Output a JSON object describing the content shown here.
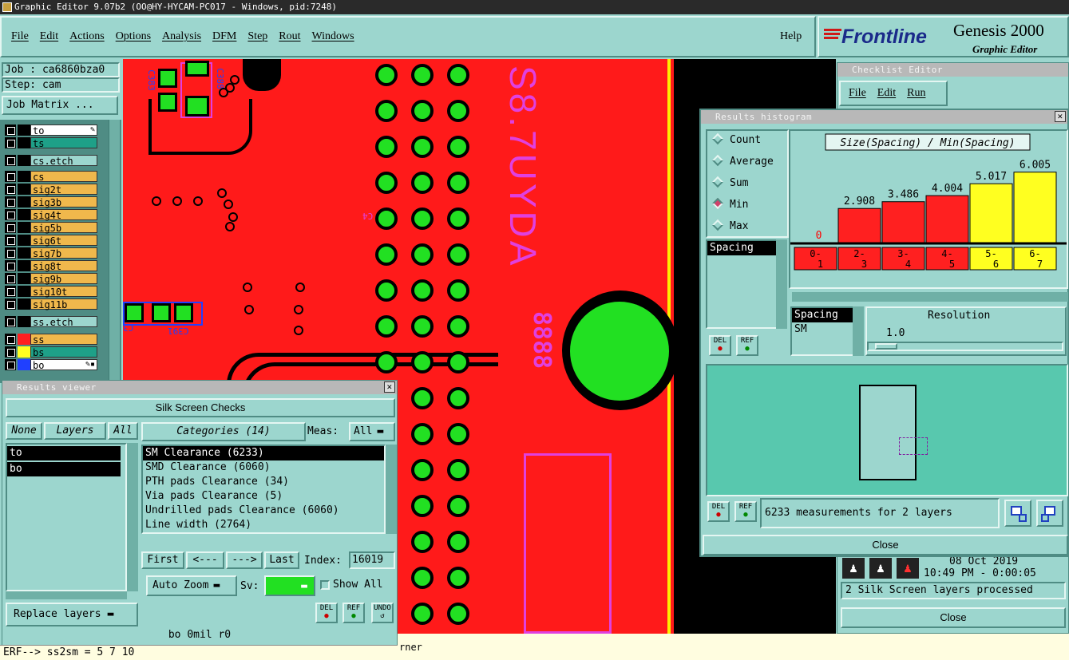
{
  "window_title": "Graphic Editor 9.07b2 (OO@HY-HYCAM-PC017 - Windows, pid:7248)",
  "menu": [
    "File",
    "Edit",
    "Actions",
    "Options",
    "Analysis",
    "DFM",
    "Step",
    "Rout",
    "Windows"
  ],
  "help_label": "Help",
  "brand": {
    "logo": "Frontline",
    "product": "Genesis 2000",
    "sub": "Graphic Editor",
    "accent": "#d01818"
  },
  "job": {
    "job_label": "Job : ca6860bza0",
    "step_label": "Step: cam",
    "matrix_button": "Job Matrix ..."
  },
  "layers": [
    {
      "name": "to",
      "color": "#000000",
      "bg": "#ffffff",
      "flag": "✎"
    },
    {
      "name": "ts",
      "color": "#000000",
      "bg": "#1ea088"
    },
    {
      "name": "cs.etch",
      "color": "#000000",
      "bg": "#9cd6ce"
    },
    {
      "name": "cs",
      "color": "#000000",
      "bg": "#f0b84c"
    },
    {
      "name": "sig2t",
      "color": "#000000",
      "bg": "#f0b84c"
    },
    {
      "name": "sig3b",
      "color": "#000000",
      "bg": "#f0b84c"
    },
    {
      "name": "sig4t",
      "color": "#000000",
      "bg": "#f0b84c"
    },
    {
      "name": "sig5b",
      "color": "#000000",
      "bg": "#f0b84c"
    },
    {
      "name": "sig6t",
      "color": "#000000",
      "bg": "#f0b84c"
    },
    {
      "name": "sig7b",
      "color": "#000000",
      "bg": "#f0b84c"
    },
    {
      "name": "sig8t",
      "color": "#000000",
      "bg": "#f0b84c"
    },
    {
      "name": "sig9b",
      "color": "#000000",
      "bg": "#f0b84c"
    },
    {
      "name": "sig10t",
      "color": "#000000",
      "bg": "#f0b84c"
    },
    {
      "name": "sig11b",
      "color": "#000000",
      "bg": "#f0b84c"
    },
    {
      "name": "ss.etch",
      "color": "#000000",
      "bg": "#9cd6ce"
    },
    {
      "name": "ss",
      "color": "#ff2020",
      "bg": "#f0b84c"
    },
    {
      "name": "bs",
      "color": "#ffff20",
      "bg": "#1ea088"
    },
    {
      "name": "bo",
      "color": "#2040ff",
      "bg": "#ffffff",
      "flag": "✎▪"
    }
  ],
  "canvas_text": {
    "silk_large": "S8.7UYDA",
    "silk_code": "8888",
    "ref1": "C383",
    "ref2": "C388",
    "ref3": "C391",
    "ref4": "C4",
    "ref5": "C3"
  },
  "results_viewer": {
    "title": "Results viewer",
    "header": "Silk Screen Checks",
    "none_btn": "None",
    "layers_btn": "Layers",
    "all_btn": "All",
    "layer_list": [
      "to",
      "bo"
    ],
    "categories_label": "Categories (14)",
    "meas_label": "Meas:",
    "meas_value": "All",
    "categories": [
      "SM Clearance (6233)",
      "SMD Clearance (6060)",
      "PTH pads Clearance (34)",
      "Via pads Clearance (5)",
      "Undrilled pads Clearance (6060)",
      "Line width (2764)"
    ],
    "first": "First",
    "prev": "<---",
    "next": "--->",
    "last": "Last",
    "index_label": "Index:",
    "index_value": "16019",
    "auto_zoom": "Auto Zoom",
    "sv_label": "Sv:",
    "show_all": "Show All",
    "replace_layers": "Replace layers",
    "del": "DEL",
    "ref": "REF",
    "undo": "UNDO",
    "status": "bo 0mil r0"
  },
  "command_line": "ERF--> ss2sm = 5 7 10",
  "corner_text": "rner",
  "checklist": {
    "title": "Checklist Editor",
    "menu": [
      "File",
      "Edit",
      "Run"
    ],
    "date": "08 Oct 2019",
    "time": "10:49 PM - 0:00:05",
    "message": "2 Silk Screen layers processed",
    "close": "Close"
  },
  "histogram": {
    "title": "Results histogram",
    "options": [
      {
        "label": "Count",
        "on": false
      },
      {
        "label": "Average",
        "on": false
      },
      {
        "label": "Sum",
        "on": false
      },
      {
        "label": "Min",
        "on": true
      },
      {
        "label": "Max",
        "on": false
      }
    ],
    "list1": [
      "Spacing"
    ],
    "list2": [
      "Spacing",
      "SM"
    ],
    "del": "DEL",
    "ref": "REF",
    "resolution_label": "Resolution",
    "resolution_value": "1.0",
    "measurements": "6233 measurements for 2 layers",
    "close": "Close"
  },
  "chart_data": {
    "type": "bar",
    "title": "Size(Spacing) / Min(Spacing)",
    "categories": [
      "0-1",
      "2-3",
      "3-4",
      "4-5",
      "5-6",
      "6-7"
    ],
    "values": [
      0,
      2.908,
      3.486,
      4.004,
      5.017,
      6.005
    ],
    "value_labels": [
      "0",
      "2.908",
      "3.486",
      "4.004",
      "5.017",
      "6.005"
    ],
    "cat_top": [
      "0-",
      "2-",
      "3-",
      "4-",
      "5-",
      "6-"
    ],
    "cat_bottom": [
      "1",
      "3",
      "4",
      "5",
      "6",
      "7"
    ],
    "colors": [
      "#ff2020",
      "#ff2020",
      "#ff2020",
      "#ff2020",
      "#ffff20",
      "#ffff20"
    ],
    "ylim": [
      0,
      6.8
    ]
  }
}
